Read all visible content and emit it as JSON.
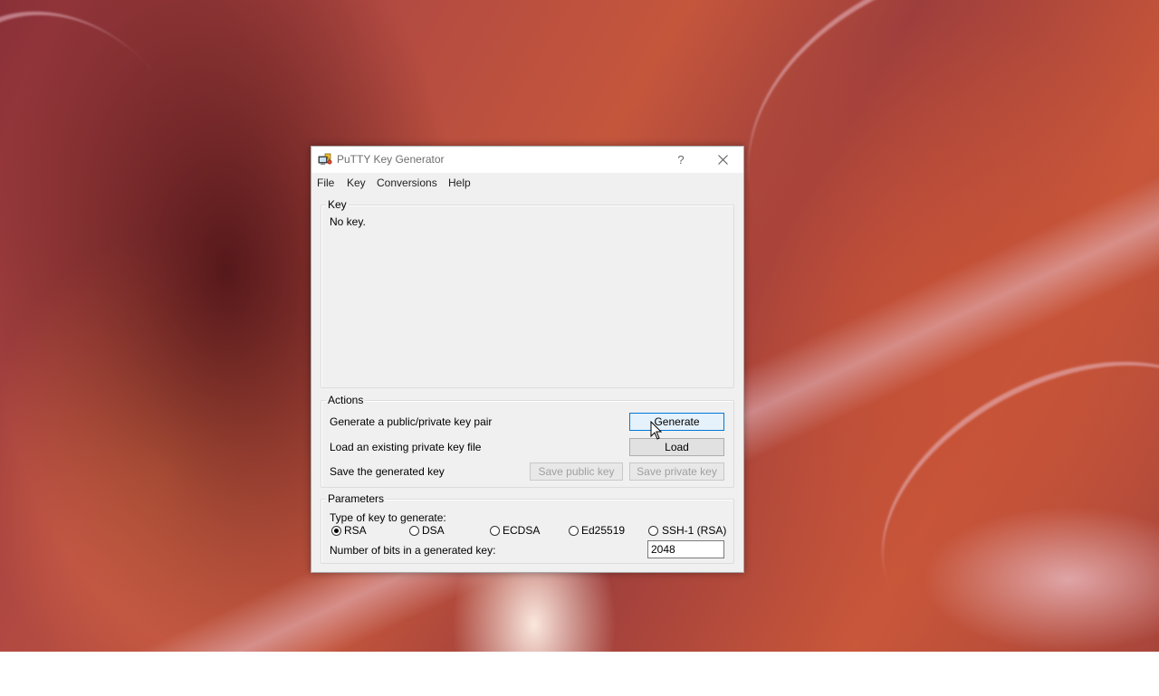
{
  "window": {
    "title": "PuTTY Key Generator",
    "help_button": "?",
    "close_button": "✕"
  },
  "menu": {
    "items": [
      {
        "label": "File"
      },
      {
        "label": "Key"
      },
      {
        "label": "Conversions"
      },
      {
        "label": "Help"
      }
    ]
  },
  "key_group": {
    "label": "Key",
    "status_text": "No key."
  },
  "actions": {
    "label": "Actions",
    "generate_text": "Generate a public/private key pair",
    "generate_button": "Generate",
    "load_text": "Load an existing private key file",
    "load_button": "Load",
    "save_text": "Save the generated key",
    "save_public_button": "Save public key",
    "save_private_button": "Save private key"
  },
  "parameters": {
    "label": "Parameters",
    "type_label": "Type of key to generate:",
    "key_types": [
      {
        "label": "RSA",
        "checked": true
      },
      {
        "label": "DSA",
        "checked": false
      },
      {
        "label": "ECDSA",
        "checked": false
      },
      {
        "label": "Ed25519",
        "checked": false
      },
      {
        "label": "SSH-1 (RSA)",
        "checked": false
      }
    ],
    "bits_label": "Number of bits in a generated key:",
    "bits_value": "2048"
  }
}
